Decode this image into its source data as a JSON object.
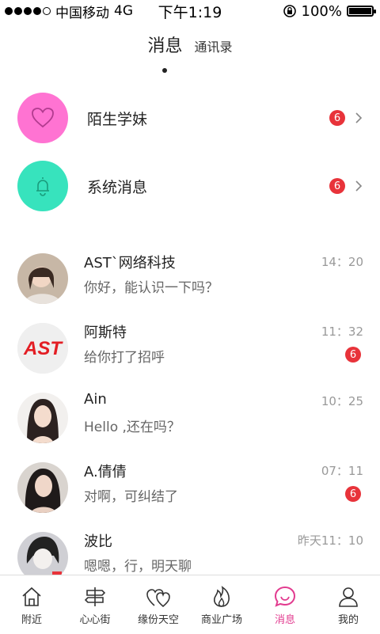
{
  "status_bar": {
    "carrier": "中国移动",
    "network": "4G",
    "time": "下午1:19",
    "battery_percent": "100%",
    "battery_level": 1.0
  },
  "header": {
    "tabs": [
      {
        "label": "消息",
        "active": true
      },
      {
        "label": "通讯录",
        "active": false
      }
    ]
  },
  "system_items": [
    {
      "label": "陌生学妹",
      "badge": "6",
      "icon": "heart-icon",
      "color": "#ff73d2"
    },
    {
      "label": "系统消息",
      "badge": "6",
      "icon": "bell-icon",
      "color": "#37e3bd"
    }
  ],
  "chats": [
    {
      "name": "AST`网络科技",
      "message": "你好，能认识一下吗？",
      "time": "14：20",
      "badge": ""
    },
    {
      "name": "阿斯特",
      "message": "给你打了招呼",
      "time": "11：32",
      "badge": "6"
    },
    {
      "name": "Ain",
      "message": "Hello ,还在吗？",
      "time": "10：25",
      "badge": ""
    },
    {
      "name": "A.倩倩",
      "message": "对啊，可纠结了",
      "time": "07：11",
      "badge": "6"
    },
    {
      "name": "波比",
      "message": "嗯嗯，行，明天聊",
      "time": "昨天11：10",
      "badge": ""
    }
  ],
  "ast_logo_text": "AST",
  "bottom_nav": [
    {
      "label": "附近",
      "icon": "home-icon",
      "active": false
    },
    {
      "label": "心心街",
      "icon": "signpost-icon",
      "active": false
    },
    {
      "label": "缘份天空",
      "icon": "hearts-icon",
      "active": false
    },
    {
      "label": "商业广场",
      "icon": "flame-icon",
      "active": false
    },
    {
      "label": "消息",
      "icon": "chat-bubble-icon",
      "active": true
    },
    {
      "label": "我的",
      "icon": "user-icon",
      "active": false
    }
  ],
  "colors": {
    "accent_pink": "#e23b8f",
    "badge_red": "#e8333a"
  }
}
